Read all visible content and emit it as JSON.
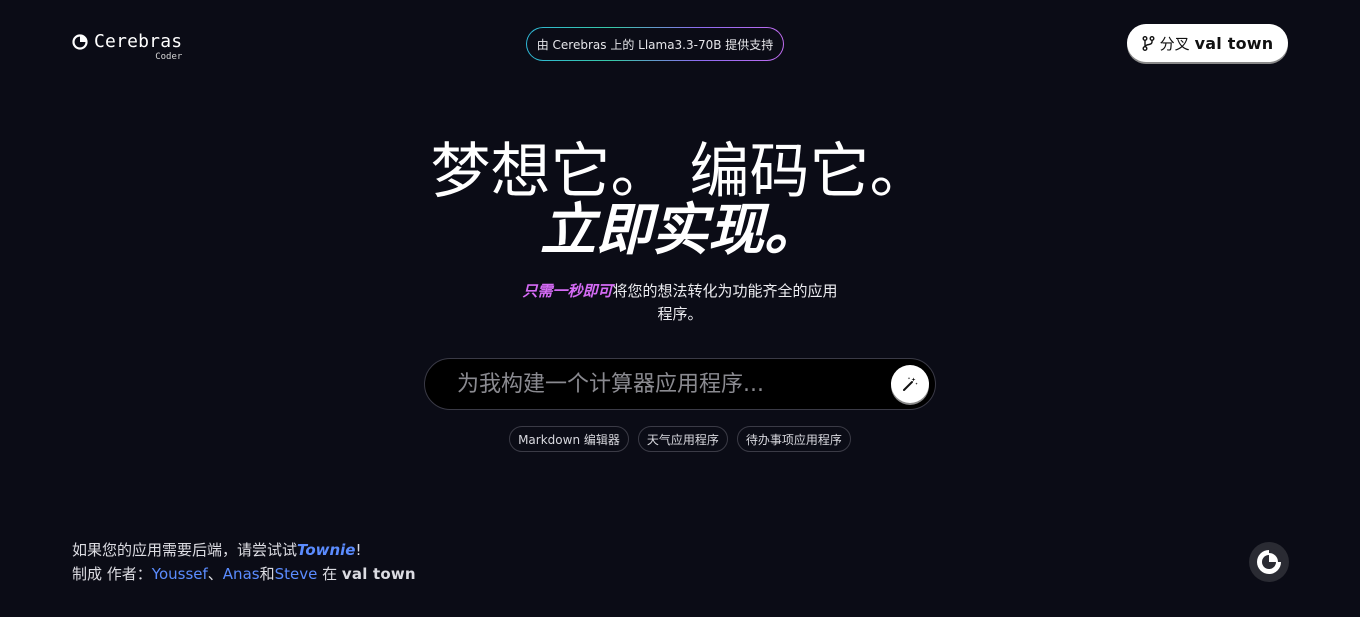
{
  "header": {
    "logo_name": "Cerebras",
    "logo_sub": "Coder",
    "powered_by": "由 Cerebras 上的 Llama3.3-70B 提供支持",
    "fork_label": "分叉",
    "fork_brand": "val town"
  },
  "hero": {
    "line1": "梦想它。 编码它。",
    "line2": "立即实现。",
    "subtitle_accent": "只需一秒即可",
    "subtitle_rest": "将您的想法转化为功能齐全的应用程序。"
  },
  "prompt": {
    "placeholder": "为我构建一个计算器应用程序...",
    "value": ""
  },
  "suggestions": [
    {
      "label": "Markdown 编辑器"
    },
    {
      "label": "天气应用程序"
    },
    {
      "label": "待办事项应用程序"
    }
  ],
  "footer": {
    "line1_prefix": "如果您的应用需要后端，请尝试试",
    "townie": "Townie",
    "line1_suffix": "!",
    "made_by": "制成 作者：",
    "author1": "Youssef",
    "sep1": "、",
    "author2": "Anas",
    "sep2": "和",
    "author3": "Steve",
    "at": " 在 ",
    "brand": "val town"
  },
  "icons": {
    "logo": "cerebras-logo-icon",
    "fork": "fork-icon",
    "magic": "magic-wand-icon",
    "corner": "cerebras-badge-icon"
  },
  "colors": {
    "background": "#0b0c16",
    "accent_purple": "#d56bf5",
    "link_blue": "#5b8cff"
  }
}
